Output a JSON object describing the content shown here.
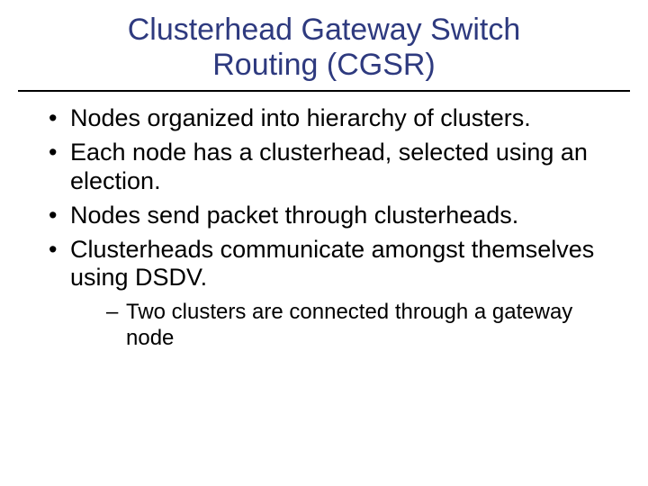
{
  "title_line1": "Clusterhead Gateway Switch",
  "title_line2": "Routing (CGSR)",
  "bullets": [
    "Nodes organized into hierarchy of clusters.",
    "Each node has a clusterhead, selected using an election.",
    "Nodes send packet through clusterheads.",
    "Clusterheads communicate amongst themselves using DSDV."
  ],
  "sub_bullets": [
    "Two clusters are connected through a gateway node"
  ]
}
